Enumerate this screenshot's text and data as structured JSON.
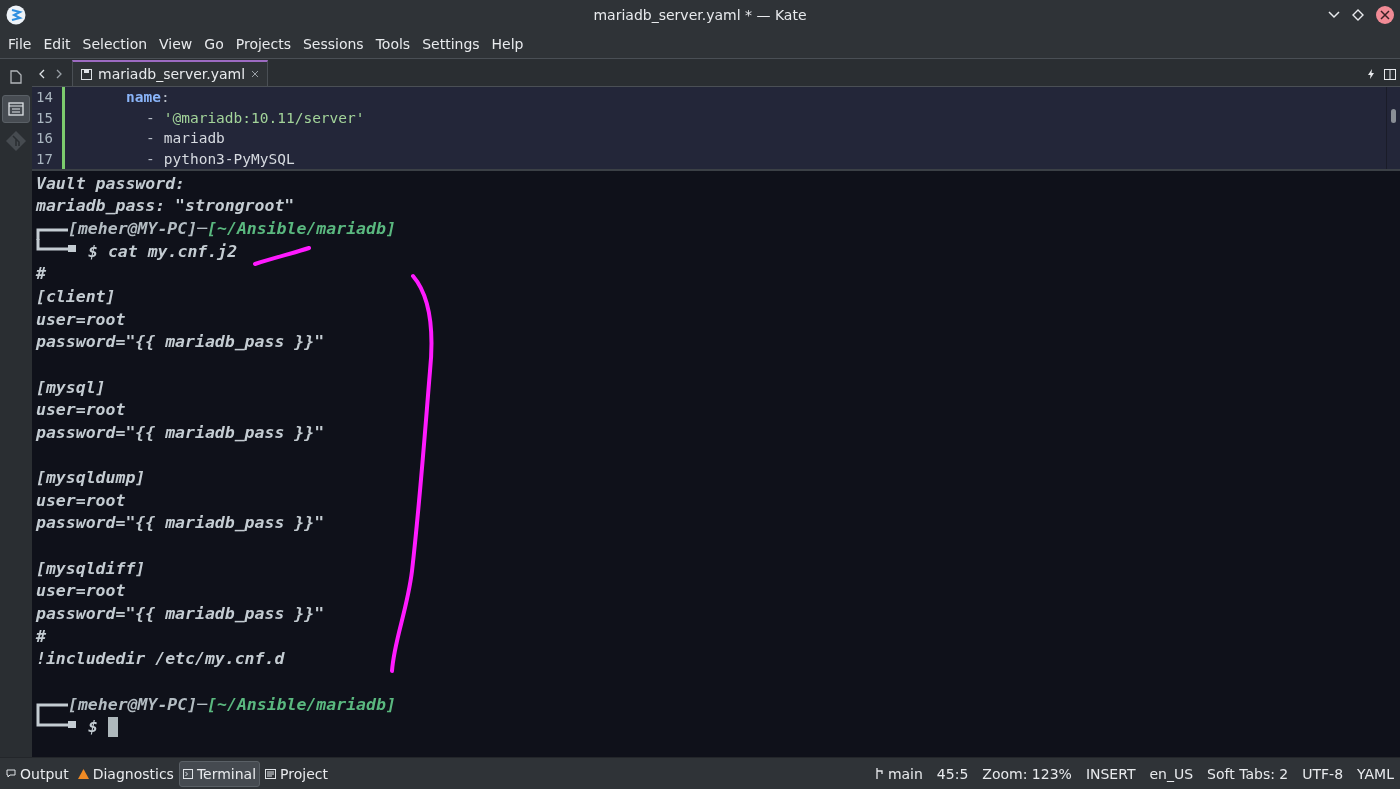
{
  "window": {
    "title": "mariadb_server.yaml * — Kate"
  },
  "menu": [
    "File",
    "Edit",
    "Selection",
    "View",
    "Go",
    "Projects",
    "Sessions",
    "Tools",
    "Settings",
    "Help"
  ],
  "sidebar": [
    {
      "kind": "documents",
      "selected": false
    },
    {
      "kind": "symbols",
      "selected": true
    },
    {
      "kind": "git",
      "selected": false
    }
  ],
  "tab": {
    "label": "mariadb_server.yaml"
  },
  "editor": {
    "lines": [
      {
        "number": "14",
        "kind": "mapping",
        "segments": [
          {
            "kind": "key",
            "text": "name"
          },
          {
            "kind": "punct",
            "text": ":"
          }
        ]
      },
      {
        "number": "15",
        "kind": "list-item",
        "segments": [
          {
            "kind": "punct",
            "text": "-"
          },
          {
            "kind": "string",
            "text": "'@mariadb:10.11/server'"
          }
        ]
      },
      {
        "number": "16",
        "kind": "list-item",
        "segments": [
          {
            "kind": "punct",
            "text": "-"
          },
          {
            "kind": "plain",
            "text": "mariadb"
          }
        ]
      },
      {
        "number": "17",
        "kind": "list-item",
        "segments": [
          {
            "kind": "punct",
            "text": "-"
          },
          {
            "kind": "plain",
            "text": "python3-PyMySQL"
          }
        ]
      }
    ]
  },
  "terminal": {
    "lines": [
      {
        "kind": "text",
        "text": "Vault password:"
      },
      {
        "kind": "text",
        "text": "mariadb_pass: \"strongroot\""
      },
      {
        "kind": "prompt",
        "user": "[meher@MY-PC]",
        "separator": "─",
        "path": "[~/Ansible/mariadb]"
      },
      {
        "kind": "command",
        "symbol": "$",
        "text": "cat my.cnf.j2"
      },
      {
        "kind": "text",
        "text": "#"
      },
      {
        "kind": "text",
        "text": "[client]"
      },
      {
        "kind": "text",
        "text": "user=root"
      },
      {
        "kind": "text",
        "text": "password=\"{{ mariadb_pass }}\""
      },
      {
        "kind": "blank"
      },
      {
        "kind": "text",
        "text": "[mysql]"
      },
      {
        "kind": "text",
        "text": "user=root"
      },
      {
        "kind": "text",
        "text": "password=\"{{ mariadb_pass }}\""
      },
      {
        "kind": "blank"
      },
      {
        "kind": "text",
        "text": "[mysqldump]"
      },
      {
        "kind": "text",
        "text": "user=root"
      },
      {
        "kind": "text",
        "text": "password=\"{{ mariadb_pass }}\""
      },
      {
        "kind": "blank"
      },
      {
        "kind": "text",
        "text": "[mysqldiff]"
      },
      {
        "kind": "text",
        "text": "user=root"
      },
      {
        "kind": "text",
        "text": "password=\"{{ mariadb_pass }}\""
      },
      {
        "kind": "text",
        "text": "#"
      },
      {
        "kind": "text",
        "text": "!includedir /etc/my.cnf.d"
      },
      {
        "kind": "blank"
      },
      {
        "kind": "prompt",
        "user": "[meher@MY-PC]",
        "separator": "─",
        "path": "[~/Ansible/mariadb]"
      },
      {
        "kind": "input",
        "symbol": "$"
      }
    ]
  },
  "bottom_tabs": [
    {
      "label": "Output",
      "kind": "output",
      "selected": false
    },
    {
      "label": "Diagnostics",
      "kind": "diagnostics",
      "selected": false
    },
    {
      "label": "Terminal",
      "kind": "terminal",
      "selected": true
    },
    {
      "label": "Project",
      "kind": "project",
      "selected": false
    }
  ],
  "status_bar": {
    "branch": "main",
    "items": [
      "45:5",
      "Zoom: 123%",
      "INSERT",
      "en_US",
      "Soft Tabs: 2",
      "UTF-8",
      "YAML"
    ]
  }
}
